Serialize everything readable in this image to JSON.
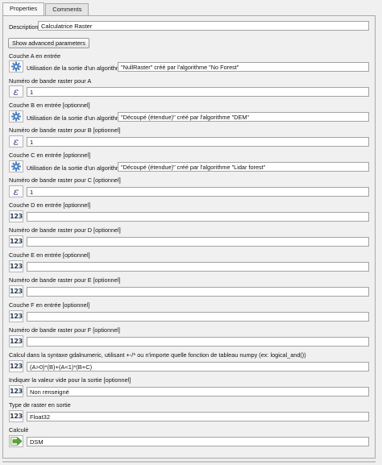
{
  "tabs": [
    {
      "label": "Properties"
    },
    {
      "label": "Comments"
    }
  ],
  "description": {
    "label": "Description",
    "value": "Calculatrice Raster"
  },
  "advanced_button": "Show advanced parameters",
  "layer_a": {
    "label": "Couche A en entrée",
    "source_label": "Utilisation de la sortie d'un algorithme",
    "source_value": "\"NullRaster\" créé par l'algorithme \"No Forest\""
  },
  "band_a": {
    "label": "Numéro de bande raster pour A",
    "value": "1"
  },
  "layer_b": {
    "label": "Couche B en entrée [optionnel]",
    "source_label": "Utilisation de la sortie d'un algorithme",
    "source_value": "\"Découpé (étendue)\" créé par l'algorithme \"DEM\""
  },
  "band_b": {
    "label": "Numéro de bande raster pour B [optionnel]",
    "value": "1"
  },
  "layer_c": {
    "label": "Couche C en entrée [optionnel]",
    "source_label": "Utilisation de la sortie d'un algorithme",
    "source_value": "\"Découpé (étendue)\" créé par l'algorithme \"Lidar forest\""
  },
  "band_c": {
    "label": "Numéro de bande raster pour C [optionnel]",
    "value": "1"
  },
  "layer_d": {
    "label": "Couche D en entrée [optionnel]",
    "value": ""
  },
  "band_d": {
    "label": "Numéro de bande raster pour D [optionnel]",
    "value": ""
  },
  "layer_e": {
    "label": "Couche E en entrée [optionnel]",
    "value": ""
  },
  "band_e": {
    "label": "Numéro de bande raster pour E [optionnel]",
    "value": ""
  },
  "layer_f": {
    "label": "Couche F en entrée [optionnel]",
    "value": ""
  },
  "band_f": {
    "label": "Numéro de bande raster pour F [optionnel]",
    "value": ""
  },
  "formula": {
    "label": "Calcul dans la syntaxe gdalnumeric, utilisant +-/* ou n'importe quelle fonction de tableau numpy (ex: logical_and())",
    "value": "(A>0)*(B)+(A<1)*(B+C)"
  },
  "nodata": {
    "label": "Indiquer la valeur vide pour la sortie [optionnel]",
    "value": "Non renseigné"
  },
  "raster_type": {
    "label": "Type de raster en sortie",
    "value": "Float32"
  },
  "output": {
    "label": "Calculé",
    "value": "DSM"
  },
  "icons": {
    "algorithm_output": "gear-cog-icon",
    "expression": "epsilon-expression-icon",
    "static_value": "123-value-icon",
    "model_output": "green-arrow-output-icon"
  },
  "colors": {
    "panel_bg": "#f0f0f0",
    "field_bg": "#ffffff",
    "border": "#a4a4a4",
    "gear_blue": "#4a7fc0",
    "arrow_green": "#58a83a"
  }
}
